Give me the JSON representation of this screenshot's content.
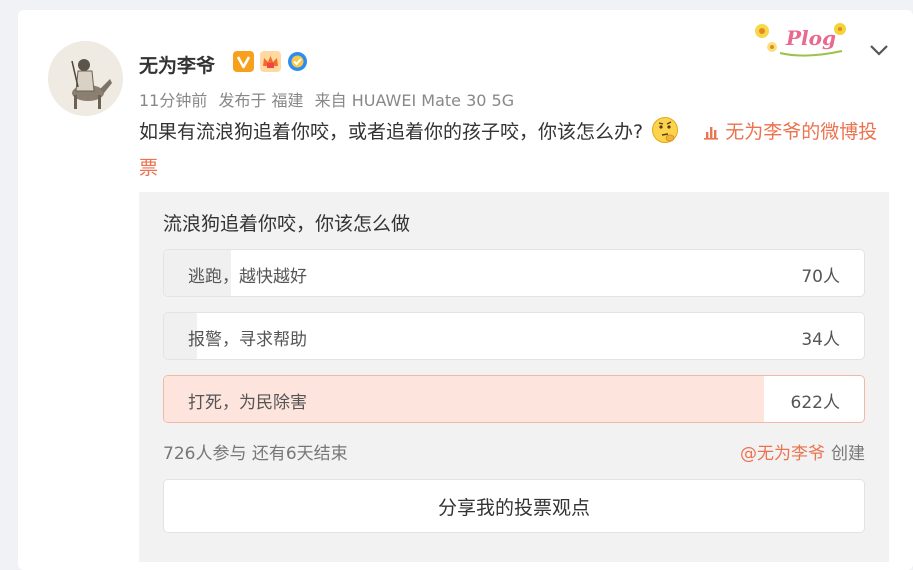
{
  "post": {
    "author": "无为李爷",
    "badges": [
      "vip-v-badge",
      "crown-fan-badge",
      "verified-blue-badge"
    ],
    "sticker": "Plog",
    "meta": {
      "time": "11分钟前",
      "location": "发布于 福建",
      "source": "来自 HUAWEI Mate 30 5G"
    },
    "text": "如果有流浪狗追着你咬，或者追着你的孩子咬，你该怎么办?",
    "vote_link": "无为李爷的微博投票"
  },
  "poll": {
    "title": "流浪狗追着你咬，你该怎么做",
    "options": [
      {
        "label": "逃跑，越快越好",
        "count": "70人",
        "share": 0.096,
        "selected": false
      },
      {
        "label": "报警，寻求帮助",
        "count": "34人",
        "share": 0.047,
        "selected": false
      },
      {
        "label": "打死，为民除害",
        "count": "622人",
        "share": 0.857,
        "selected": true
      }
    ],
    "stats": "726人参与 还有6天结束",
    "creator_handle": "@无为李爷",
    "creator_suffix": "创建",
    "share_button": "分享我的投票观点"
  },
  "colors": {
    "accent": "#eb7350",
    "selected_fill": "#fde4dc",
    "option_fill": "#f0f0f0"
  }
}
